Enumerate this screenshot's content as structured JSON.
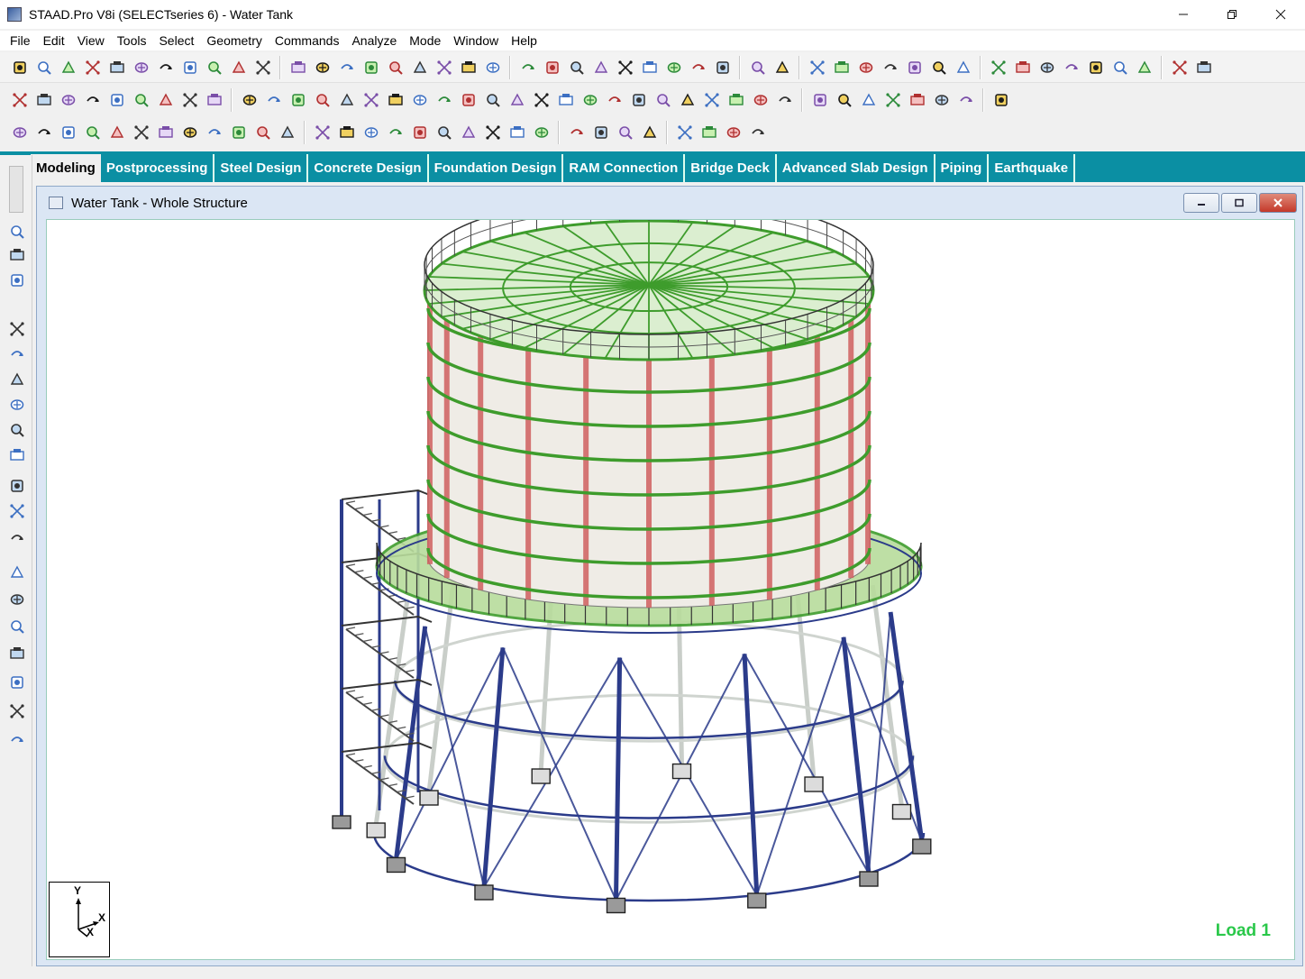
{
  "window": {
    "title": "STAAD.Pro V8i (SELECTseries 6)  - Water Tank",
    "controls": [
      "minimize",
      "restore",
      "close"
    ]
  },
  "menu": {
    "items": [
      "File",
      "Edit",
      "View",
      "Tools",
      "Select",
      "Geometry",
      "Commands",
      "Analyze",
      "Mode",
      "Window",
      "Help"
    ]
  },
  "mode_tabs": {
    "active": "Modeling",
    "items": [
      "Modeling",
      "Postprocessing",
      "Steel Design",
      "Concrete Design",
      "Foundation Design",
      "RAM Connection",
      "Bridge Deck",
      "Advanced Slab Design",
      "Piping",
      "Earthquake"
    ]
  },
  "child_window": {
    "title": "Water Tank - Whole Structure"
  },
  "viewport": {
    "load_label": "Load 1",
    "axes": {
      "y": "Y",
      "x": "X",
      "z": "X"
    }
  },
  "colors": {
    "mode_tab_bar": "#0b8fa3",
    "load_label": "#2ac84a",
    "roof_members": "#3e9c2c",
    "column_members": "#2b3b8a",
    "vertical_stiffeners": "#d06060",
    "tank_shell": "#efece6"
  },
  "icons": {
    "toolbar1": [
      "new-file-icon",
      "open-folder-icon",
      "save-icon",
      "save-all-icon",
      "cut-icon",
      "copy-icon",
      "paste-icon",
      "structure-wizard-icon",
      "undo-icon",
      "redo-icon",
      "print-icon",
      "zoom-in-icon",
      "zoom-out-icon",
      "view-3d-icon",
      "zoom-window-icon",
      "zoom-all-icon",
      "zoom-previous-icon",
      "zoom-dynamic-icon",
      "pan-icon",
      "magnifier-icon",
      "selection-cursor-icon",
      "node-cursor-icon",
      "rotate-icon",
      "isometric-view-icon",
      "front-view-icon",
      "top-view-icon",
      "side-view-icon",
      "rotate-up-icon",
      "rotate-down-icon",
      "spin-left-icon",
      "spin-right-icon",
      "nodes-cursor-icon",
      "beams-cursor-icon",
      "plates-cursor-icon",
      "solids-cursor-icon",
      "surface-cursor-icon",
      "geometry-cursor-icon",
      "labels-icon",
      "display-icon",
      "symbols-icon",
      "load-display-icon",
      "structure-diagram-icon",
      "plot-icon",
      "refresh-icon",
      "snap-node-icon",
      "add-beam-icon",
      "add-plate-icon"
    ],
    "toolbar2": [
      "node-icon",
      "beam-icon",
      "plate-icon",
      "solid-icon",
      "surface-icon",
      "pencil-icon",
      "circle-icon",
      "arc-icon",
      "cube-icon",
      "translational-repeat-icon",
      "circular-repeat-icon",
      "mirror-icon",
      "rotate-geometry-icon",
      "move-icon",
      "stretch-icon",
      "merge-icon",
      "split-icon",
      "intersect-icon",
      "renumber-icon",
      "cut-section-icon",
      "insert-node-icon",
      "add-node-icon",
      "connect-beams-icon",
      "merge-beams-icon",
      "break-beams-icon",
      "offset-icon",
      "generate-plate-icon",
      "mesh-icon",
      "infill-plate-icon",
      "circular-mesh-icon",
      "grid-icon",
      "snap-icon",
      "node-snap-icon",
      "beam-snap-icon",
      "plate-snap-icon",
      "solid-snap-icon",
      "sphere-icon",
      "settings-icon",
      "cylinder-icon",
      "export-icon"
    ],
    "toolbar3": [
      "member-property-icon",
      "beta-angle-icon",
      "support-icon",
      "load-icon",
      "material-icon",
      "spec-icon",
      "release-icon",
      "offset-spec-icon",
      "truss-icon",
      "cable-icon",
      "tension-only-icon",
      "compression-only-icon",
      "section-icon",
      "pipe-icon",
      "tube-icon",
      "prismatic-icon",
      "tapered-icon",
      "user-table-icon",
      "plate-thickness-icon",
      "load-case-icon",
      "load-combo-icon",
      "repeat-load-icon",
      "envelope-icon",
      "analysis-icon",
      "post-analysis-icon",
      "annotation-icon",
      "dimension-icon",
      "add-icon",
      "plus-icon",
      "plus-red-icon"
    ],
    "sidebar": [
      "page-control-icon",
      "setup-icon",
      "geometry-icon",
      "general-icon",
      "property-icon",
      "spec-icon",
      "support-icon",
      "load-icon",
      "material-icon",
      "analysis-icon",
      "design-icon",
      "loads-icon",
      "command-icon",
      "results-icon",
      "report-icon",
      "output-icon",
      "print-icon",
      "export-icon",
      "tools-icon"
    ]
  }
}
